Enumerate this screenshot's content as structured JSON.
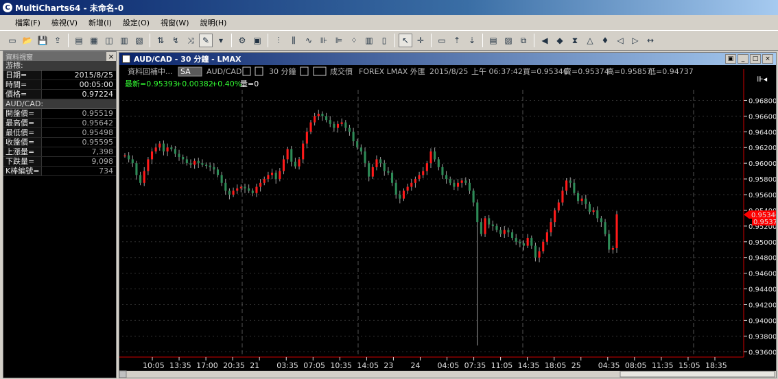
{
  "window": {
    "title": "MultiCharts64 - 未命名-0",
    "icon": "multicharts-logo-icon"
  },
  "menu": [
    "檔案(F)",
    "檢視(V)",
    "新增(I)",
    "設定(O)",
    "視窗(W)",
    "說明(H)"
  ],
  "toolbar": {
    "buttons": [
      "new-icon",
      "open-icon",
      "save-icon",
      "export-icon",
      "chart-icon",
      "chart-tile-icon",
      "chart-cascade-icon",
      "chart-grid-icon",
      "chart-list-icon",
      "insert-study-icon",
      "insert-drawing-icon",
      "insert-signal-icon",
      "pen-icon",
      "dropdown-icon",
      "strategy-icon",
      "format-icon",
      "bar-icon",
      "candle-icon",
      "line-icon",
      "ohlc-icon",
      "hlc-icon",
      "point-icon",
      "histogram-icon",
      "candle-hollow-icon",
      "cursor-icon",
      "crosshair-icon",
      "comment-icon",
      "scale-up-icon",
      "scale-down-icon",
      "data-window-icon",
      "chart-image-icon",
      "screenshot-icon",
      "play-back-icon",
      "play-step-icon",
      "zoom-icon",
      "triangle-icon",
      "bell-icon",
      "arrow-left-icon",
      "arrow-right-icon",
      "arrow-lr-icon"
    ]
  },
  "data_window": {
    "title": "資料視窗",
    "close": "×",
    "cursor_label": "游標:",
    "rows_top": [
      {
        "k": "日期=",
        "v": "2015/8/25"
      },
      {
        "k": "時間=",
        "v": "00:05:00"
      },
      {
        "k": "價格=",
        "v": "0.97224"
      }
    ],
    "symbol_label": "AUD/CAD:",
    "rows_bottom": [
      {
        "k": "開盤價=",
        "v": "0.95519"
      },
      {
        "k": "最高價=",
        "v": "0.95642"
      },
      {
        "k": "最低價=",
        "v": "0.95498"
      },
      {
        "k": "收盤價=",
        "v": "0.95595"
      },
      {
        "k": "上漲量=",
        "v": "7,398"
      },
      {
        "k": "下跌量=",
        "v": "9,098"
      },
      {
        "k": "K棒編號=",
        "v": "734"
      }
    ]
  },
  "chart_window": {
    "title": "AUD/CAD - 30 分鐘 - LMAX",
    "controls": [
      "▣",
      "_",
      "□",
      "×"
    ],
    "header_line1": {
      "loading": "資料回補中...",
      "sa_badge": "SA",
      "symbol": "AUD/CAD",
      "interval": "30 分鐘",
      "quote_type": "成交價",
      "feed": "FOREX  LMAX  外匯",
      "date": "2015/8/25",
      "time": "上午 06:37:42",
      "bid": "買=0.95346",
      "ask": "賣=0.95374",
      "high": "高=0.95857",
      "low": "低=0.94737"
    },
    "header_line2": {
      "last": "最新=0.95393",
      "change": "+0.00382",
      "pct": "+0.40%",
      "volume": "量=0"
    },
    "last_price_marker": "0.95346",
    "second_marker": "0.95373",
    "arrow_icon": "scroll-right-icon"
  },
  "chart_data": {
    "type": "candlestick",
    "ylim": [
      0.9355,
      0.969
    ],
    "yticks": [
      "0.96800",
      "0.96600",
      "0.96400",
      "0.96200",
      "0.96000",
      "0.95800",
      "0.95600",
      "0.95400",
      "0.95200",
      "0.95000",
      "0.94800",
      "0.94600",
      "0.94400",
      "0.94200",
      "0.94000",
      "0.93800",
      "0.93600"
    ],
    "ytick_values": [
      0.968,
      0.966,
      0.964,
      0.962,
      0.96,
      0.958,
      0.956,
      0.954,
      0.952,
      0.95,
      0.948,
      0.946,
      0.944,
      0.942,
      0.94,
      0.938,
      0.936
    ],
    "xticks": [
      "10:05",
      "13:35",
      "17:00",
      "20:35",
      "21",
      "03:35",
      "07:05",
      "10:35",
      "14:05",
      "23",
      "24",
      "04:05",
      "07:35",
      "11:05",
      "14:35",
      "18:05",
      "25",
      "04:35",
      "08:05",
      "11:35",
      "15:05",
      "18:35"
    ],
    "grid": true,
    "colors": {
      "up": "#ff1a1a",
      "down": "#2e8b57",
      "wick": "#a0a0a0",
      "background": "#000000",
      "grid": "#333333",
      "marker": "#ff0000"
    },
    "candles_close": [
      0.961,
      0.9605,
      0.96,
      0.9585,
      0.9575,
      0.959,
      0.9605,
      0.9615,
      0.962,
      0.9625,
      0.9615,
      0.962,
      0.9618,
      0.9612,
      0.9608,
      0.9605,
      0.96,
      0.9598,
      0.9603,
      0.96,
      0.9598,
      0.9597,
      0.9595,
      0.9592,
      0.9585,
      0.9575,
      0.9565,
      0.956,
      0.9565,
      0.9568,
      0.957,
      0.9568,
      0.9565,
      0.9562,
      0.957,
      0.9575,
      0.958,
      0.9585,
      0.9588,
      0.958,
      0.959,
      0.9605,
      0.9618,
      0.9602,
      0.9596,
      0.9605,
      0.9625,
      0.964,
      0.9652,
      0.966,
      0.9663,
      0.966,
      0.9655,
      0.965,
      0.9645,
      0.965,
      0.9652,
      0.9645,
      0.964,
      0.9628,
      0.962,
      0.9615,
      0.96,
      0.9583,
      0.9595,
      0.9605,
      0.96,
      0.959,
      0.9588,
      0.9575,
      0.956,
      0.9555,
      0.9565,
      0.957,
      0.9575,
      0.958,
      0.9585,
      0.959,
      0.96,
      0.9615,
      0.9605,
      0.9595,
      0.9585,
      0.958,
      0.9575,
      0.957,
      0.9575,
      0.9578,
      0.9575,
      0.9565,
      0.955,
      0.9525,
      0.951,
      0.953,
      0.9522,
      0.952,
      0.9515,
      0.951,
      0.9515,
      0.9512,
      0.9505,
      0.95,
      0.9498,
      0.9495,
      0.9505,
      0.9495,
      0.948,
      0.9488,
      0.95,
      0.9512,
      0.9525,
      0.954,
      0.955,
      0.9565,
      0.9578,
      0.9575,
      0.9562,
      0.9552,
      0.9555,
      0.9548,
      0.9538,
      0.954,
      0.953,
      0.9525,
      0.951,
      0.949,
      0.9492,
      0.9535
    ]
  }
}
